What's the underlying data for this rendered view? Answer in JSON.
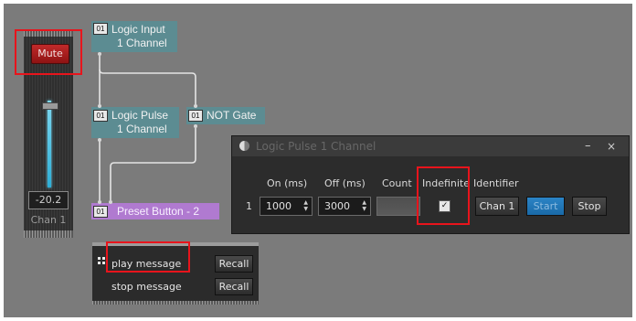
{
  "colors": {
    "canvas_bg": "#7b7b7b",
    "node_teal": "#5c8c92",
    "preset_purple": "#b07ad0",
    "mute_red": "#b01f1f",
    "highlight_red": "#e8141c",
    "fader_blue": "#4fc3e6",
    "start_blue": "#2178bc"
  },
  "fader": {
    "mute_label": "Mute",
    "value": "-20.2",
    "channel_label": "Chan 1"
  },
  "nodes": {
    "logic_input": {
      "badge": "01",
      "title": "Logic Input",
      "subtitle": "1 Channel"
    },
    "logic_pulse": {
      "badge": "01",
      "title": "Logic Pulse",
      "subtitle": "1 Channel"
    },
    "not_gate": {
      "badge": "01",
      "title": "NOT Gate"
    },
    "preset_button": {
      "badge": "01",
      "title": "Preset Button - 2"
    }
  },
  "messages": {
    "play_label": "play message",
    "stop_label": "stop message",
    "recall_label": "Recall"
  },
  "dialog": {
    "title": "Logic Pulse 1 Channel",
    "minimize_icon": "–",
    "close_icon": "×",
    "columns": {
      "on": "On (ms)",
      "off": "Off (ms)",
      "count": "Count",
      "indefinite": "Indefinite",
      "identifier": "Identifier"
    },
    "row": {
      "number": "1",
      "on_value": "1000",
      "off_value": "3000",
      "count_value": "",
      "indefinite_checked": true,
      "identifier": "Chan 1",
      "start_label": "Start",
      "stop_label": "Stop"
    }
  }
}
